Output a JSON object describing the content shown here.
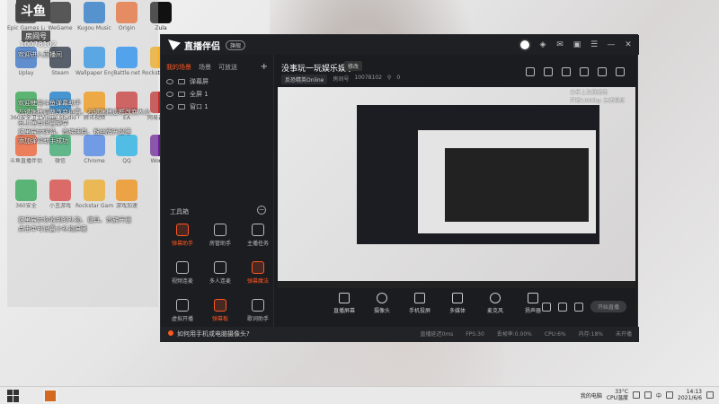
{
  "desktop": {
    "icons": [
      {
        "label": "Epic Games Launcher",
        "color": "#222222"
      },
      {
        "label": "WeGame",
        "color": "#1b1b1b"
      },
      {
        "label": "Kugou Music",
        "color": "#1976d2"
      },
      {
        "label": "Origin",
        "color": "#f56c2d"
      },
      {
        "label": "Zula",
        "color": "#111111"
      },
      {
        "label": "Uplay",
        "color": "#2a6fd1"
      },
      {
        "label": "Steam",
        "color": "#1b2838"
      },
      {
        "label": "Wallpaper Engine",
        "color": "#2196f3"
      },
      {
        "label": "Battle.net",
        "color": "#148eff"
      },
      {
        "label": "Rockstar Games",
        "color": "#fcaf17"
      },
      {
        "label": "360安全卫士",
        "color": "#22aa44"
      },
      {
        "label": "Visual Studio Code",
        "color": "#0078d4"
      },
      {
        "label": "腾讯视频",
        "color": "#ff9900"
      },
      {
        "label": "EA",
        "color": "#d32f2f"
      },
      {
        "label": "网易云音乐",
        "color": "#c62828"
      },
      {
        "label": "斗鱼直播伴侣",
        "color": "#ff5722"
      },
      {
        "label": "微信",
        "color": "#2aae67"
      },
      {
        "label": "Chrome",
        "color": "#4285f4"
      },
      {
        "label": "QQ",
        "color": "#12b7f5"
      },
      {
        "label": "Wonder",
        "color": "#6a1b9a"
      },
      {
        "label": "360安全",
        "color": "#1faa4a"
      },
      {
        "label": "小丑游戏",
        "color": "#e53935"
      },
      {
        "label": "Rockstar Games Launcher",
        "color": "#fcaf17"
      },
      {
        "label": "游戏加速",
        "color": "#ff8f00"
      }
    ]
  },
  "overlay": {
    "brand": "斗鱼",
    "room_tag": "房间号",
    "room_id": "10078102",
    "greeting_line": "欢迎进入直播间",
    "guide_lines": [
      "欢迎使用斗鱼弹幕助手",
      "左键拖拽调整改变位置，右键拖拽边框改变大小",
      "右上角有设置菜单",
      "这里展示弹幕、贵族续费、粉丝牌升级等",
      "添加弹幕助手成功"
    ],
    "gift_lines": [
      "这里展示你收到的礼物、道具、贵族开通",
      "点击单可设置小礼物屏蔽"
    ]
  },
  "app": {
    "name": "直播伴侣",
    "version_badge": "旗舰",
    "scene_tabs": [
      "我的场景",
      "场景",
      "可放送"
    ],
    "sources": [
      "弹幕屏",
      "全屏 1",
      "窗口 1"
    ],
    "toolbox_title": "工具箱",
    "tools": [
      {
        "label": "弹幕助手",
        "orange": true
      },
      {
        "label": "房管助手",
        "orange": false
      },
      {
        "label": "主播任务",
        "orange": false
      },
      {
        "label": "视频连麦",
        "orange": false
      },
      {
        "label": "多人连麦",
        "orange": false
      },
      {
        "label": "弹幕魔法",
        "orange": true
      },
      {
        "label": "虚拟开播",
        "orange": false
      },
      {
        "label": "弹幕板",
        "orange": true
      },
      {
        "label": "歌词助手",
        "orange": false
      }
    ],
    "bottom_link": "如何用手机或电脑摄像头?",
    "stats": [
      "直播延迟0ms",
      "FPS:30",
      "丢帧率:0.00%",
      "CPU:6%",
      "内存:18%",
      "未开播"
    ],
    "room": {
      "title": "没事玩一玩娱乐娱乐",
      "modify": "修改",
      "category": "反恐精英Online",
      "room_label": "房间号",
      "room_id": "10078102",
      "viewers": "0"
    },
    "preview_overlay": [
      "分享上次直播完",
      "开播100Kbp 主播视频"
    ],
    "controls": [
      "直播屏幕",
      "摄像头",
      "手机投屏",
      "多媒体",
      "麦克风",
      "扬声器"
    ],
    "go_live": "开始直播"
  },
  "taskbar": {
    "task_app": "直播伴侣",
    "speed_label": "我的电脑",
    "temp": "33°C",
    "temp_label": "CPU温度",
    "ime": "中",
    "time": "14:13",
    "date": "2021/6/6"
  }
}
